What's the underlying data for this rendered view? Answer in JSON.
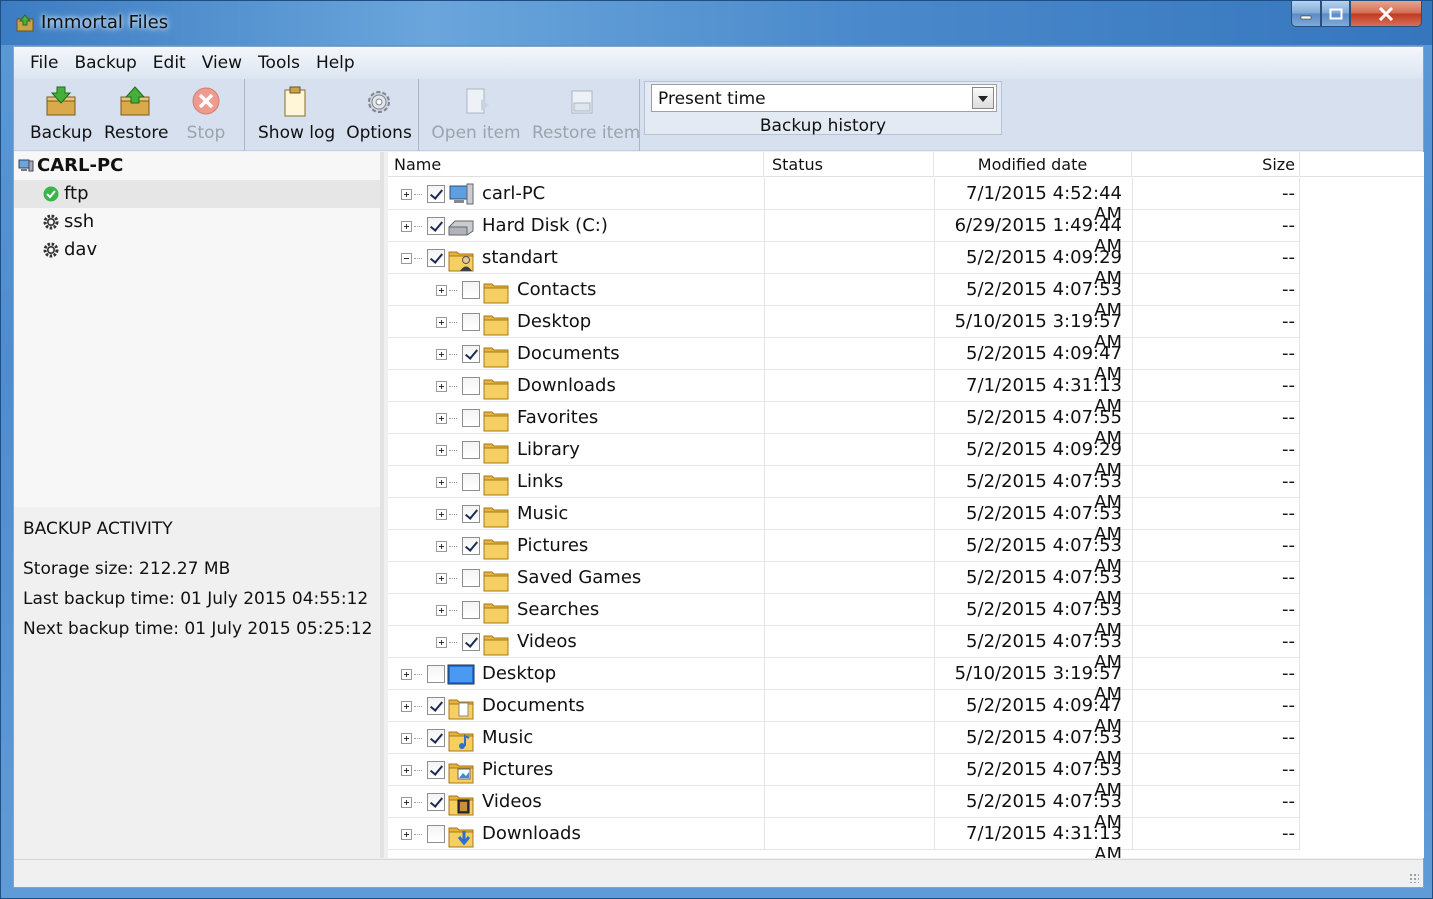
{
  "window": {
    "title": "Immortal Files"
  },
  "menu": [
    "File",
    "Backup",
    "Edit",
    "View",
    "Tools",
    "Help"
  ],
  "toolbar": {
    "backup": "Backup",
    "restore": "Restore",
    "stop": "Stop",
    "show_log": "Show log",
    "options": "Options",
    "open_item": "Open item",
    "restore_item": "Restore item",
    "history_value": "Present time",
    "history_label": "Backup history"
  },
  "left_tree": {
    "root": "CARL-PC",
    "items": [
      {
        "label": "ftp",
        "icon": "green-check-icon",
        "selected": true
      },
      {
        "label": "ssh",
        "icon": "gear-icon",
        "selected": false
      },
      {
        "label": "dav",
        "icon": "gear-icon",
        "selected": false
      }
    ]
  },
  "activity": {
    "heading": "BACKUP ACTIVITY",
    "storage": "Storage size: 212.27 MB",
    "last": "Last backup time: 01 July 2015 04:55:12",
    "next": "Next backup time: 01 July 2015 05:25:12"
  },
  "grid": {
    "columns": {
      "name": "Name",
      "status": "Status",
      "modified": "Modified date",
      "size": "Size"
    },
    "rows": [
      {
        "level": 0,
        "expander": "plus",
        "checked": true,
        "icon": "computer-icon",
        "name": "carl-PC",
        "status": "",
        "modified": "7/1/2015 4:52:44 AM",
        "size": "--"
      },
      {
        "level": 0,
        "expander": "plus",
        "checked": true,
        "icon": "hard-disk-icon",
        "name": "Hard Disk (C:)",
        "status": "",
        "modified": "6/29/2015 1:49:44 AM",
        "size": "--"
      },
      {
        "level": 0,
        "expander": "minus",
        "checked": true,
        "icon": "user-folder-icon",
        "name": "standart",
        "status": "",
        "modified": "5/2/2015 4:09:29 AM",
        "size": "--"
      },
      {
        "level": 1,
        "expander": "plus",
        "checked": false,
        "icon": "folder-icon",
        "name": "Contacts",
        "status": "",
        "modified": "5/2/2015 4:07:53 AM",
        "size": "--"
      },
      {
        "level": 1,
        "expander": "plus",
        "checked": false,
        "icon": "folder-icon",
        "name": "Desktop",
        "status": "",
        "modified": "5/10/2015 3:19:57 AM",
        "size": "--"
      },
      {
        "level": 1,
        "expander": "plus",
        "checked": true,
        "icon": "folder-icon",
        "name": "Documents",
        "status": "",
        "modified": "5/2/2015 4:09:47 AM",
        "size": "--"
      },
      {
        "level": 1,
        "expander": "plus",
        "checked": false,
        "icon": "folder-icon",
        "name": "Downloads",
        "status": "",
        "modified": "7/1/2015 4:31:13 AM",
        "size": "--"
      },
      {
        "level": 1,
        "expander": "plus",
        "checked": false,
        "icon": "folder-icon",
        "name": "Favorites",
        "status": "",
        "modified": "5/2/2015 4:07:55 AM",
        "size": "--"
      },
      {
        "level": 1,
        "expander": "plus",
        "checked": false,
        "icon": "folder-icon",
        "name": "Library",
        "status": "",
        "modified": "5/2/2015 4:09:29 AM",
        "size": "--"
      },
      {
        "level": 1,
        "expander": "plus",
        "checked": false,
        "icon": "folder-icon",
        "name": "Links",
        "status": "",
        "modified": "5/2/2015 4:07:53 AM",
        "size": "--"
      },
      {
        "level": 1,
        "expander": "plus",
        "checked": true,
        "icon": "folder-icon",
        "name": "Music",
        "status": "",
        "modified": "5/2/2015 4:07:53 AM",
        "size": "--"
      },
      {
        "level": 1,
        "expander": "plus",
        "checked": true,
        "icon": "folder-icon",
        "name": "Pictures",
        "status": "",
        "modified": "5/2/2015 4:07:53 AM",
        "size": "--"
      },
      {
        "level": 1,
        "expander": "plus",
        "checked": false,
        "icon": "folder-icon",
        "name": "Saved Games",
        "status": "",
        "modified": "5/2/2015 4:07:53 AM",
        "size": "--"
      },
      {
        "level": 1,
        "expander": "plus",
        "checked": false,
        "icon": "folder-icon",
        "name": "Searches",
        "status": "",
        "modified": "5/2/2015 4:07:53 AM",
        "size": "--"
      },
      {
        "level": 1,
        "expander": "plus",
        "checked": true,
        "icon": "folder-icon",
        "name": "Videos",
        "status": "",
        "modified": "5/2/2015 4:07:53 AM",
        "size": "--"
      },
      {
        "level": 0,
        "expander": "plus",
        "checked": false,
        "icon": "desktop-icon",
        "name": "Desktop",
        "status": "",
        "modified": "5/10/2015 3:19:57 AM",
        "size": "--"
      },
      {
        "level": 0,
        "expander": "plus",
        "checked": true,
        "icon": "documents-library-icon",
        "name": "Documents",
        "status": "",
        "modified": "5/2/2015 4:09:47 AM",
        "size": "--"
      },
      {
        "level": 0,
        "expander": "plus",
        "checked": true,
        "icon": "music-library-icon",
        "name": "Music",
        "status": "",
        "modified": "5/2/2015 4:07:53 AM",
        "size": "--"
      },
      {
        "level": 0,
        "expander": "plus",
        "checked": true,
        "icon": "pictures-library-icon",
        "name": "Pictures",
        "status": "",
        "modified": "5/2/2015 4:07:53 AM",
        "size": "--"
      },
      {
        "level": 0,
        "expander": "plus",
        "checked": true,
        "icon": "videos-library-icon",
        "name": "Videos",
        "status": "",
        "modified": "5/2/2015 4:07:53 AM",
        "size": "--"
      },
      {
        "level": 0,
        "expander": "plus",
        "checked": false,
        "icon": "downloads-folder-icon",
        "name": "Downloads",
        "status": "",
        "modified": "7/1/2015 4:31:13 AM",
        "size": "--"
      }
    ]
  }
}
